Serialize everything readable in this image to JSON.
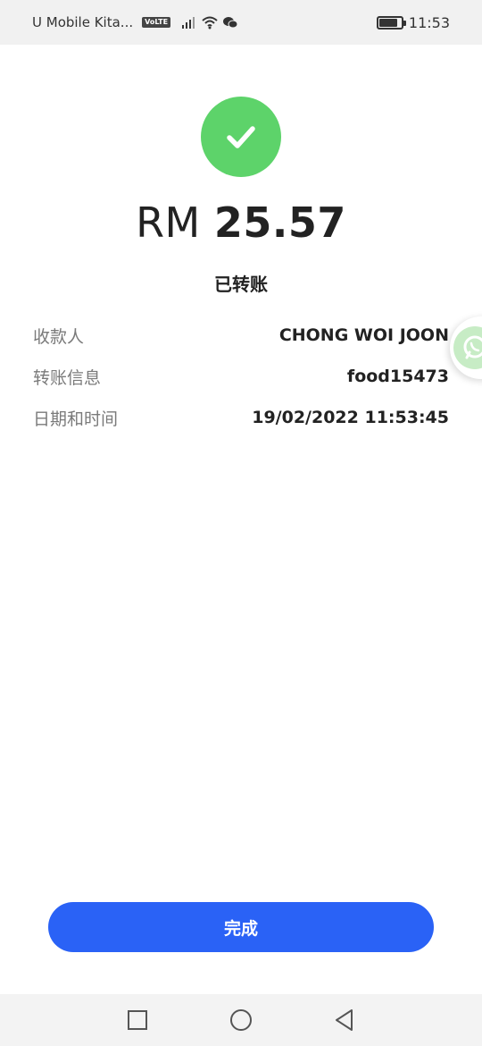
{
  "status_bar": {
    "carrier": "U Mobile Kita...",
    "volte": "VoLTE",
    "time": "11:53"
  },
  "payment": {
    "currency": "RM",
    "amount": "25.57",
    "status": "已转账"
  },
  "details": [
    {
      "label": "收款人",
      "value": "CHONG WOI JOON"
    },
    {
      "label": "转账信息",
      "value": "food15473"
    },
    {
      "label": "日期和时间",
      "value": "19/02/2022 11:53:45"
    }
  ],
  "actions": {
    "done_label": "完成"
  },
  "colors": {
    "success": "#5dd36a",
    "primary": "#2a62f6"
  },
  "icons": {
    "success": "check-icon",
    "floating": "chat-icon",
    "nav": [
      "square-icon",
      "circle-icon",
      "back-triangle-icon"
    ]
  }
}
